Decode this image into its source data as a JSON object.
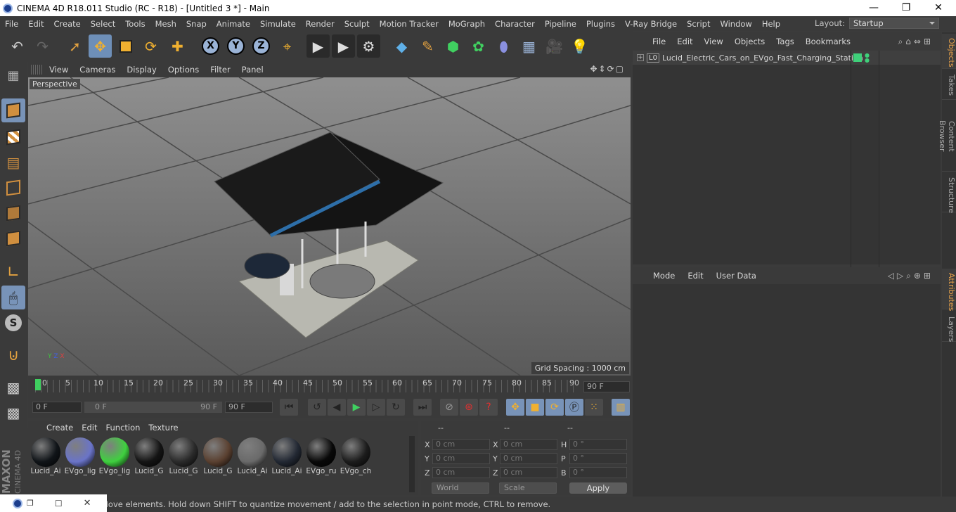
{
  "window": {
    "title": "CINEMA 4D R18.011 Studio (RC - R18) - [Untitled 3 *] - Main",
    "minimize": "—",
    "maximize": "❐",
    "close": "✕"
  },
  "menubar": {
    "items": [
      "File",
      "Edit",
      "Create",
      "Select",
      "Tools",
      "Mesh",
      "Snap",
      "Animate",
      "Simulate",
      "Render",
      "Sculpt",
      "Motion Tracker",
      "MoGraph",
      "Character",
      "Pipeline",
      "Plugins",
      "V-Ray Bridge",
      "Script",
      "Window",
      "Help"
    ],
    "layout_label": "Layout:",
    "layout_value": "Startup"
  },
  "toolbar": {
    "axis_x": "X",
    "axis_y": "Y",
    "axis_z": "Z"
  },
  "viewport": {
    "menu": [
      "View",
      "Cameras",
      "Display",
      "Options",
      "Filter",
      "Panel"
    ],
    "camera_label": "Perspective",
    "grid_spacing": "Grid Spacing : 1000 cm"
  },
  "timeline": {
    "ticks": [
      "0",
      "5",
      "10",
      "15",
      "20",
      "25",
      "30",
      "35",
      "40",
      "45",
      "50",
      "55",
      "60",
      "65",
      "70",
      "75",
      "80",
      "85",
      "90"
    ],
    "current_frame": "90 F"
  },
  "animation": {
    "start_frame": "0 F",
    "range_start": "0 F",
    "range_end": "90 F",
    "end_frame": "90 F"
  },
  "materials": {
    "menu": [
      "Create",
      "Edit",
      "Function",
      "Texture"
    ],
    "items": [
      {
        "label": "Lucid_Ai",
        "color": "#101418"
      },
      {
        "label": "EVgo_lig",
        "color": "#6a74c8"
      },
      {
        "label": "EVgo_lig",
        "color": "#3fd03f"
      },
      {
        "label": "Lucid_G",
        "color": "#141414"
      },
      {
        "label": "Lucid_G",
        "color": "#2a2a2a"
      },
      {
        "label": "Lucid_G",
        "color": "#5a4030"
      },
      {
        "label": "Lucid_Ai",
        "color": "#6a6a6a"
      },
      {
        "label": "Lucid_Ai",
        "color": "#222833"
      },
      {
        "label": "EVgo_ru",
        "color": "#080808"
      },
      {
        "label": "EVgo_ch",
        "color": "#1c1c1c"
      }
    ]
  },
  "coords": {
    "header": [
      "--",
      "--",
      "--"
    ],
    "pos": [
      {
        "axis": "X",
        "value": "0 cm"
      },
      {
        "axis": "Y",
        "value": "0 cm"
      },
      {
        "axis": "Z",
        "value": "0 cm"
      }
    ],
    "size": [
      {
        "axis": "X",
        "value": "0 cm"
      },
      {
        "axis": "Y",
        "value": "0 cm"
      },
      {
        "axis": "Z",
        "value": "0 cm"
      }
    ],
    "rot": [
      {
        "axis": "H",
        "value": "0 °"
      },
      {
        "axis": "P",
        "value": "0 °"
      },
      {
        "axis": "B",
        "value": "0 °"
      }
    ],
    "mode_world": "World",
    "mode_scale": "Scale",
    "apply": "Apply"
  },
  "objects": {
    "menu": [
      "File",
      "Edit",
      "View",
      "Objects",
      "Tags",
      "Bookmarks"
    ],
    "row_name": "Lucid_Electric_Cars_on_EVgo_Fast_Charging_Station",
    "layer_tag": "L0"
  },
  "attributes": {
    "menu": [
      "Mode",
      "Edit",
      "User Data"
    ]
  },
  "sidetabs": [
    "Objects",
    "Takes",
    "Content Browser",
    "Structure",
    "Attributes",
    "Layers"
  ],
  "status": {
    "text": "Move elements. Hold down SHIFT to quantize movement / add to the selection in point mode, CTRL to remove."
  },
  "logo": {
    "maxon": "MAXON",
    "c4d": "CINEMA 4D"
  }
}
